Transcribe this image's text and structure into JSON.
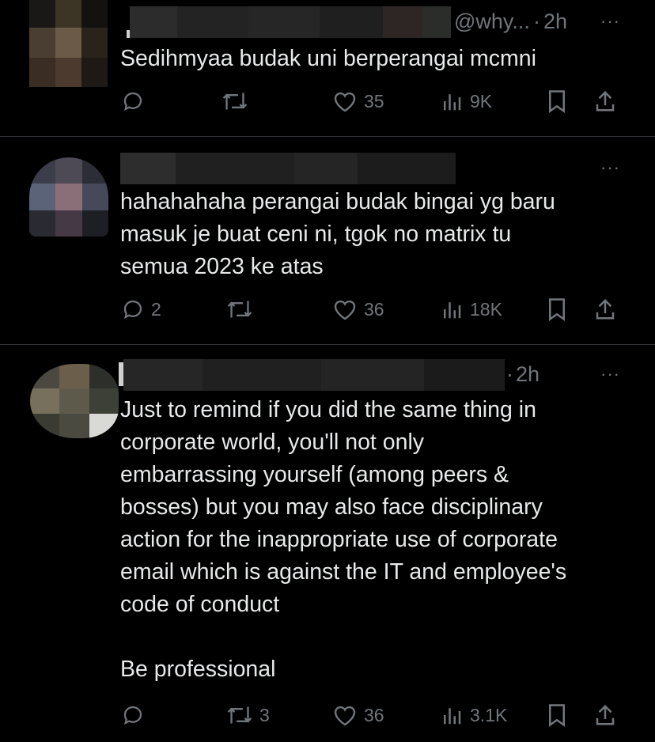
{
  "tweets": [
    {
      "handle": "@why...",
      "separator": "·",
      "time": "2h",
      "more": "···",
      "text": "Sedihmyaa budak uni berperangai mcmni",
      "actions": {
        "reply": "",
        "retweet": "",
        "like": "35",
        "views": "9K"
      }
    },
    {
      "handle": "",
      "separator": "",
      "time": "",
      "more": "···",
      "text": "hahahahaha perangai budak bingai yg baru\nmasuk je buat ceni ni, tgok no matrix tu\nsemua 2023 ke atas",
      "actions": {
        "reply": "2",
        "retweet": "",
        "like": "36",
        "views": "18K"
      }
    },
    {
      "handle": "",
      "separator": "·",
      "time": "2h",
      "more": "···",
      "text": "Just to remind if you did the same thing in\ncorporate world, you'll not only\nembarrassing yourself (among peers &\nbosses) but you may also face disciplinary\naction for the inappropriate use of corporate\nemail which is against the IT and employee's\ncode of conduct\n\nBe professional",
      "actions": {
        "reply": "",
        "retweet": "3",
        "like": "36",
        "views": "3.1K"
      }
    }
  ],
  "colors": {
    "background": "#000000",
    "text": "#e7e9ea",
    "secondary": "#71767b",
    "divider": "#2f3336"
  }
}
